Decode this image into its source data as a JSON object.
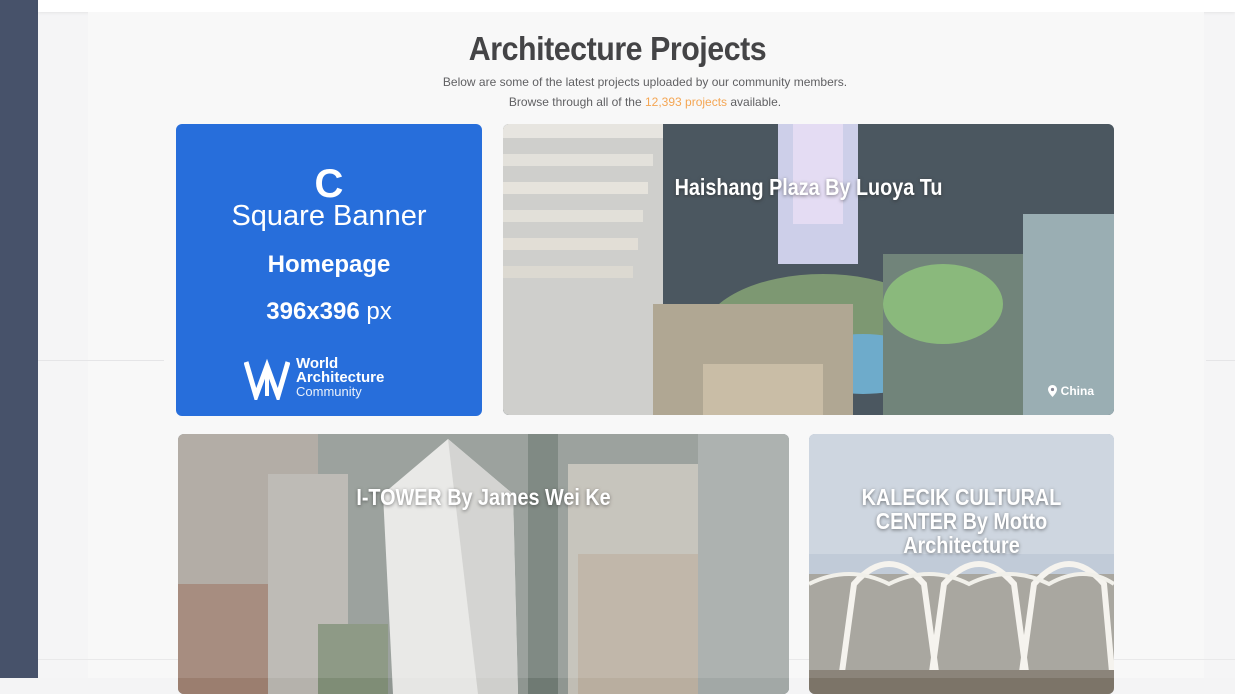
{
  "page": {
    "heading": "Architecture Projects",
    "subtext_line1": "Below are some of the latest projects uploaded by our community members.",
    "subtext_line2_prefix": "Browse through all of the ",
    "project_count_link": "12,393 projects",
    "subtext_line2_suffix": " available."
  },
  "banner": {
    "letter": "C",
    "title": "Square Banner",
    "placement": "Homepage",
    "size_value": "396x396",
    "size_unit": "px",
    "logo_line1": "World",
    "logo_line2": "Architecture",
    "logo_line3": "Community"
  },
  "projects": [
    {
      "title": "Haishang Plaza By Luoya Tu",
      "location": "China"
    },
    {
      "title": "I-TOWER By James Wei Ke",
      "location": ""
    },
    {
      "title": "KALECIK CULTURAL CENTER By Motto Architecture",
      "location": ""
    }
  ],
  "colors": {
    "banner_blue": "#0a5bd6",
    "accent_orange": "#f39a3c",
    "rail_navy": "#2e3b56"
  }
}
